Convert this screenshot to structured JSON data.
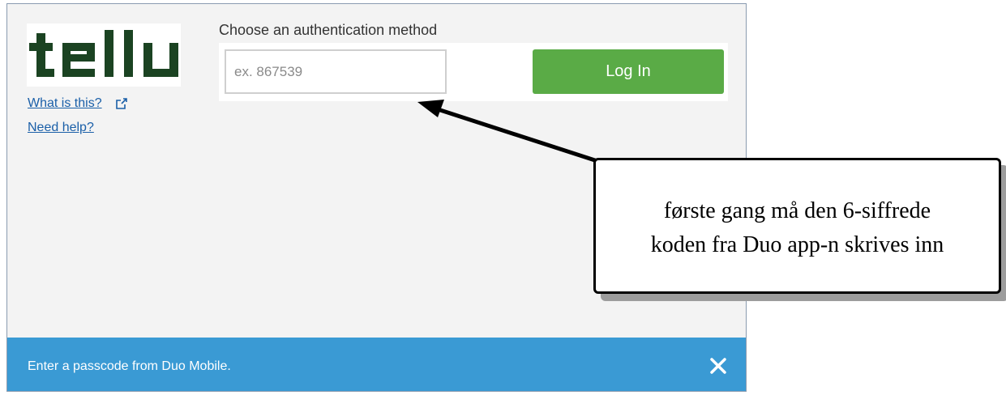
{
  "brand": {
    "logo_text": "tellu",
    "logo_color": "#1b4322"
  },
  "links": {
    "what_is_this": "What is this?",
    "need_help": "Need help?"
  },
  "auth": {
    "method_label": "Choose an authentication method",
    "passcode_placeholder": "ex. 867539",
    "passcode_value": "",
    "login_label": "Log In"
  },
  "status": {
    "message": "Enter a passcode from Duo Mobile.",
    "close_icon": "close-icon"
  },
  "annotation": {
    "line1": "første gang må den 6-siffrede",
    "line2": "koden fra Duo app-n skrives inn"
  },
  "colors": {
    "login_button": "#5aab46",
    "status_bar": "#3a9ad4",
    "link": "#1a5fa8"
  }
}
